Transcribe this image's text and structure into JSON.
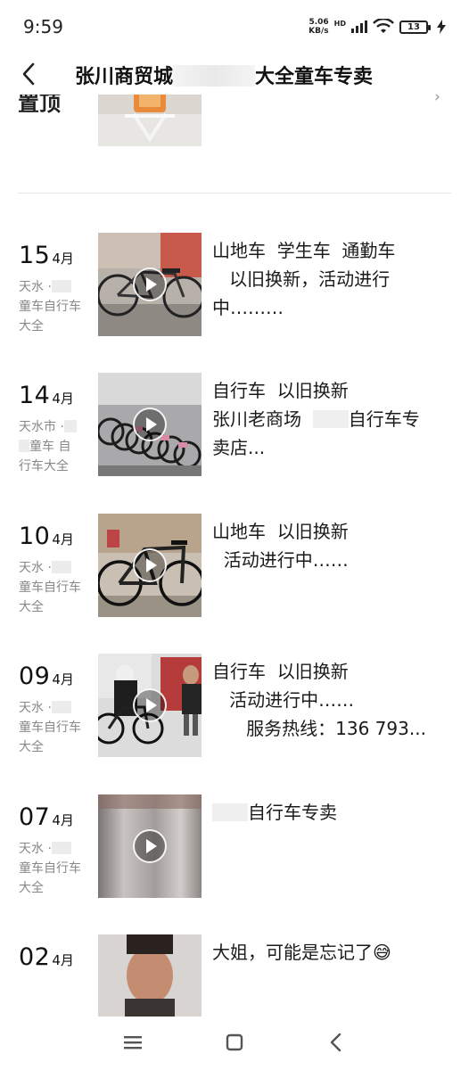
{
  "status_bar": {
    "time": "9:59",
    "net_speed_value": "5.06",
    "net_speed_unit": "KB/s",
    "net_type": "HD",
    "battery": "13"
  },
  "header": {
    "title_left": "张川商贸城",
    "title_right": "大全童车专卖"
  },
  "partial_post": {
    "title": "置顶"
  },
  "posts": [
    {
      "day": "15",
      "month": "4月",
      "loc_line1": "天水 ·",
      "loc_line2": "童车自行车",
      "loc_line3": "大全",
      "caption": "山地车  学生车  通勤车\n   以旧换新，活动进行\n中………"
    },
    {
      "day": "14",
      "month": "4月",
      "loc_line1": "天水市 ·",
      "loc_line2": "童车 自",
      "loc_line3": "行车大全",
      "caption_line1": "自行车  以旧换新",
      "caption_line2a": "张川老商场  ",
      "caption_line2b": "自行车专",
      "caption_line3": "卖店..."
    },
    {
      "day": "10",
      "month": "4月",
      "loc_line1": "天水 ·",
      "loc_line2": "童车自行车",
      "loc_line3": "大全",
      "caption": "山地车  以旧换新\n  活动进行中……"
    },
    {
      "day": "09",
      "month": "4月",
      "loc_line1": "天水 ·",
      "loc_line2": "童车自行车",
      "loc_line3": "大全",
      "caption": "自行车  以旧换新\n   活动进行中……\n      服务热线：136 793..."
    },
    {
      "day": "07",
      "month": "4月",
      "loc_line1": "天水 ·",
      "loc_line2": "童车自行车",
      "loc_line3": "大全",
      "caption": "自行车专卖"
    },
    {
      "day": "02",
      "month": "4月",
      "caption": "大姐，可能是忘记了😅"
    }
  ],
  "colors": {
    "text": "#1a1a1a",
    "secondary_text": "#888888",
    "divider": "#e6e6e6"
  },
  "icons": {
    "back": "chevron-left-icon",
    "play": "play-circle-icon",
    "menu": "menu-icon",
    "home": "square-home-icon",
    "nav_back": "triangle-back-icon"
  }
}
